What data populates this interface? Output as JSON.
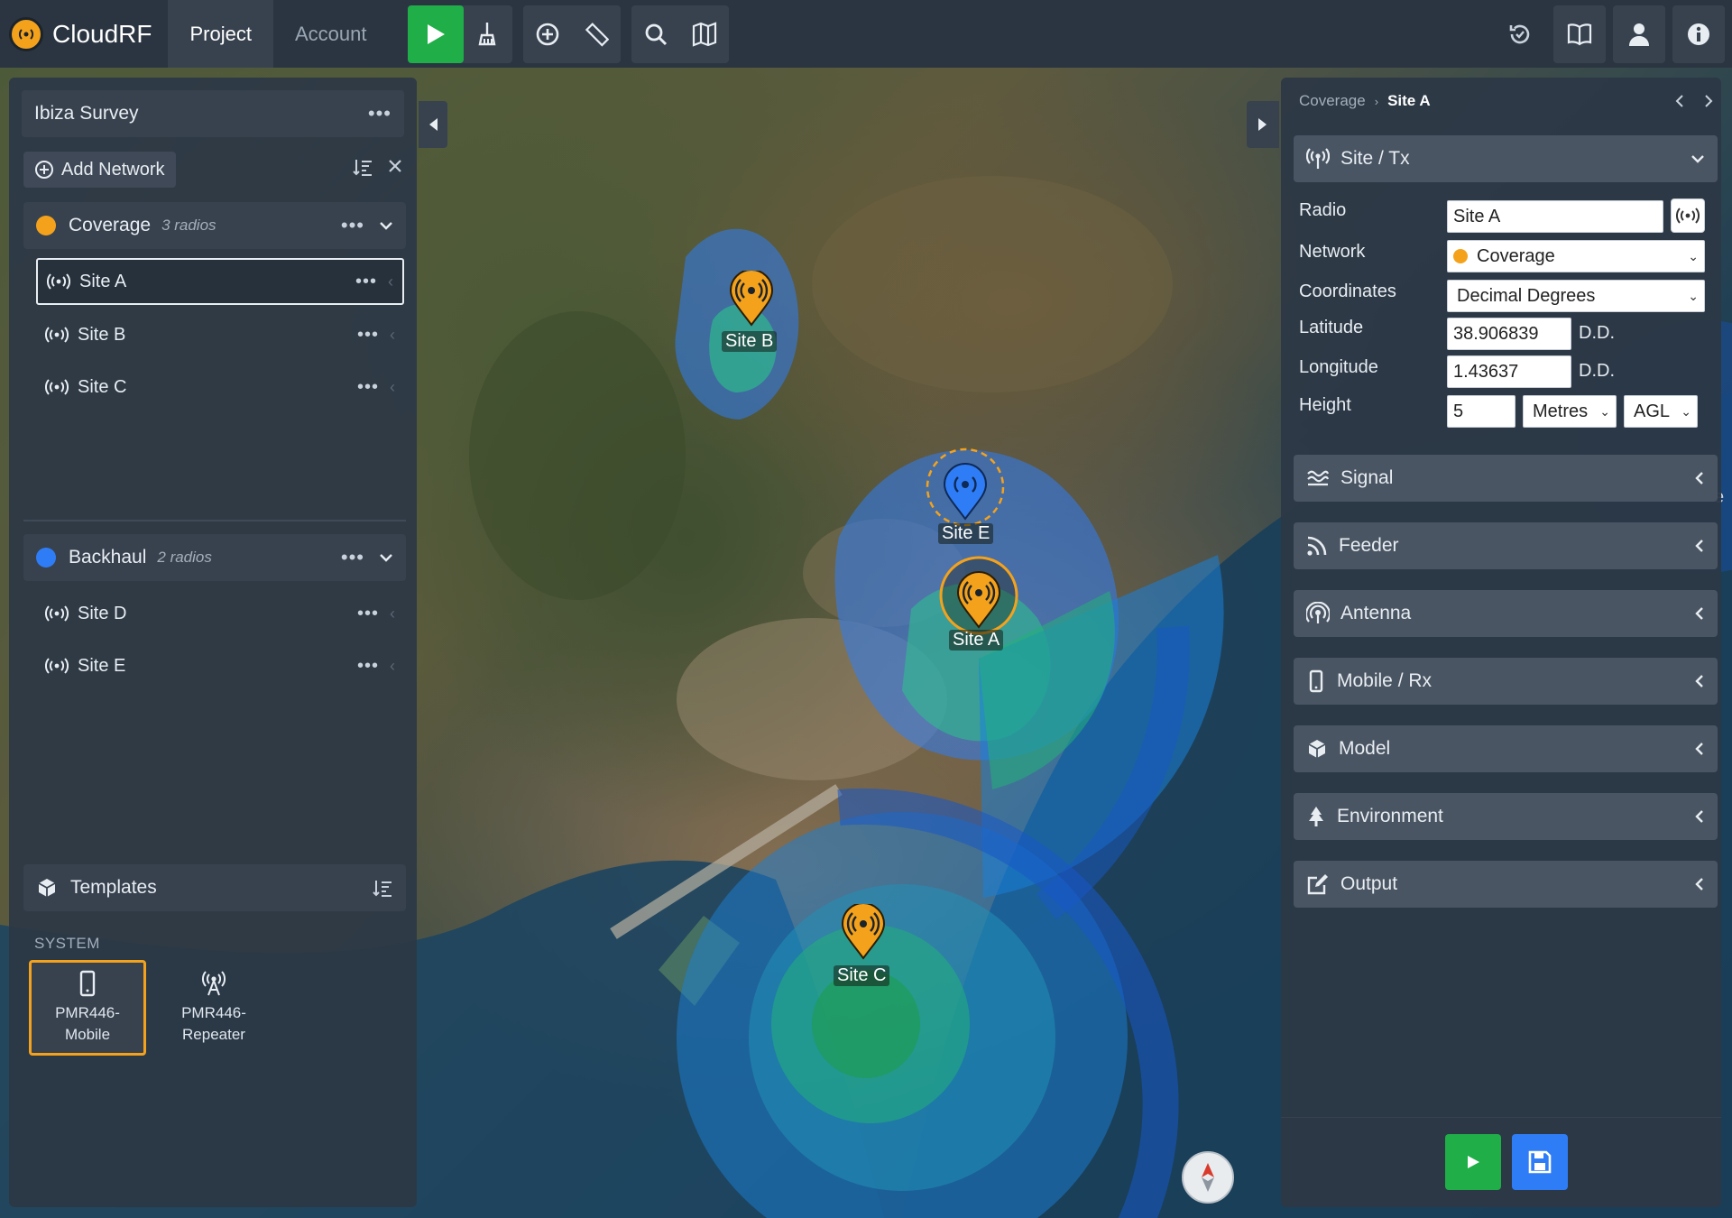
{
  "app": {
    "title": "CloudRF"
  },
  "nav": {
    "tabs": [
      {
        "label": "Project"
      },
      {
        "label": "Account"
      }
    ]
  },
  "toolbar": {
    "icons": [
      "play-icon",
      "broom-icon",
      "plus-circle-icon",
      "ruler-icon",
      "search-icon",
      "map-icon"
    ],
    "right_icons": [
      "history-icon",
      "book-icon",
      "user-icon",
      "info-icon"
    ]
  },
  "left_panel": {
    "project_name": "Ibiza Survey",
    "add_network_label": "Add Network",
    "networks": [
      {
        "name": "Coverage",
        "count": "3 radios",
        "color": "#f4a21c",
        "radios": [
          "Site A",
          "Site B",
          "Site C"
        ]
      },
      {
        "name": "Backhaul",
        "count": "2 radios",
        "color": "#2f7df6",
        "radios": [
          "Site D",
          "Site E"
        ]
      }
    ],
    "templates": {
      "title": "Templates",
      "group_label": "SYSTEM",
      "items": [
        {
          "line1": "PMR446-",
          "line2": "Mobile"
        },
        {
          "line1": "PMR446-",
          "line2": "Repeater"
        }
      ]
    }
  },
  "map": {
    "markers": [
      {
        "label": "Site B",
        "color": "#f4a21c"
      },
      {
        "label": "Site E",
        "color": "#2f7df6"
      },
      {
        "label": "Site A",
        "color": "#f4a21c"
      },
      {
        "label": "Site C",
        "color": "#f4a21c"
      }
    ],
    "edge_marker_text": "e"
  },
  "right_panel": {
    "breadcrumb": {
      "parent": "Coverage",
      "current": "Site A"
    },
    "site_tx": {
      "title": "Site / Tx",
      "labels": {
        "radio": "Radio",
        "network": "Network",
        "coordinates": "Coordinates",
        "latitude": "Latitude",
        "longitude": "Longitude",
        "height": "Height"
      },
      "radio_value": "Site A",
      "network_value": "Coverage",
      "coordinates_value": "Decimal Degrees",
      "latitude_value": "38.906839",
      "longitude_value": "1.43637",
      "unit_dd": "D.D.",
      "height_value": "5",
      "height_unit": "Metres",
      "height_ref": "AGL"
    },
    "sections": [
      {
        "title": "Signal",
        "icon": "waves-icon"
      },
      {
        "title": "Feeder",
        "icon": "rss-icon"
      },
      {
        "title": "Antenna",
        "icon": "antenna-icon"
      },
      {
        "title": "Mobile / Rx",
        "icon": "mobile-icon"
      },
      {
        "title": "Model",
        "icon": "cube-icon"
      },
      {
        "title": "Environment",
        "icon": "tree-icon"
      },
      {
        "title": "Output",
        "icon": "edit-icon"
      }
    ]
  },
  "colors": {
    "accent": "#f4a21c",
    "run": "#1fae47",
    "save": "#2f7df6",
    "backhaul": "#2f7df6"
  }
}
